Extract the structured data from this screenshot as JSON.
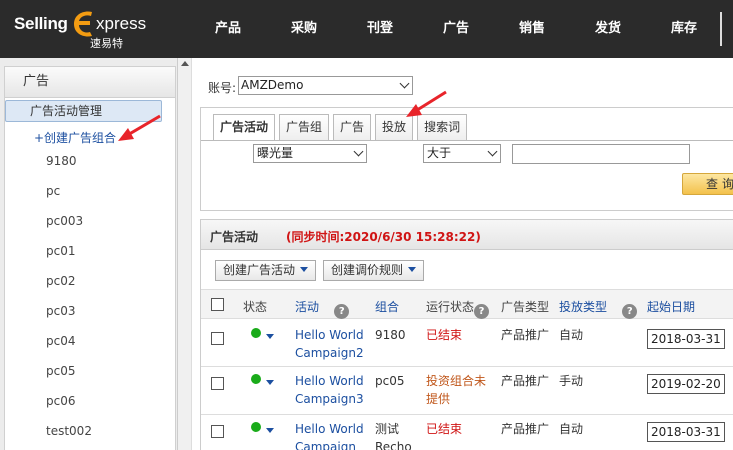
{
  "brand": {
    "part1": "Selling",
    "part2": "xpress",
    "cn_name": "速易特"
  },
  "nav": [
    "产品",
    "采购",
    "刊登",
    "广告",
    "销售",
    "发货",
    "库存"
  ],
  "sidebar": {
    "header": "广告",
    "active_item": "广告活动管理",
    "create_link": "+创建广告组合",
    "items": [
      "9180",
      "pc",
      "pc003",
      "pc01",
      "pc02",
      "pc03",
      "pc04",
      "pc05",
      "pc06",
      "test002"
    ]
  },
  "account": {
    "label": "账号:",
    "value": "AMZDemo"
  },
  "filter": {
    "tabs": [
      "广告活动",
      "广告组",
      "广告",
      "投放",
      "搜索词"
    ],
    "active_tab": 0,
    "metric_value": "曝光量",
    "operator_value": "大于",
    "input_value": "",
    "query_label": "查询"
  },
  "list": {
    "title": "广告活动",
    "sync_time": "(同步时间:2020/6/30 15:28:22)",
    "buttons": [
      "创建广告活动",
      "创建调价规则"
    ],
    "columns": {
      "status": "状态",
      "campaign": "活动",
      "portfolio": "组合",
      "run_status": "运行状态",
      "ad_type": "广告类型",
      "targeting": "投放类型",
      "start_date": "起始日期"
    },
    "rows": [
      {
        "name_line1": "Hello World",
        "name_line2": "Campaign2",
        "portfolio_line1": "9180",
        "portfolio_line2": "",
        "run_line1": "已结束",
        "run_line2": "",
        "run_color": "#d01414",
        "ad_type": "产品推广",
        "targeting": "自动",
        "start_date": "2018-03-31"
      },
      {
        "name_line1": "Hello World",
        "name_line2": "Campaign3",
        "portfolio_line1": "pc05",
        "portfolio_line2": "",
        "run_line1": "投资组合未",
        "run_line2": "提供",
        "run_color": "#c0561a",
        "ad_type": "产品推广",
        "targeting": "手动",
        "start_date": "2019-02-20"
      },
      {
        "name_line1": "Hello World",
        "name_line2": "Campaign",
        "portfolio_line1": "测试",
        "portfolio_line2": "Recho",
        "run_line1": "已结束",
        "run_line2": "",
        "run_color": "#d01414",
        "ad_type": "产品推广",
        "targeting": "自动",
        "start_date": "2018-03-31"
      }
    ]
  },
  "colors": {
    "topbar": "#2b2b2b",
    "accent_orange": "#f39c12",
    "link_blue": "#1c4fa0",
    "alert_red": "#d01414",
    "annotation_red": "#e8242a"
  }
}
